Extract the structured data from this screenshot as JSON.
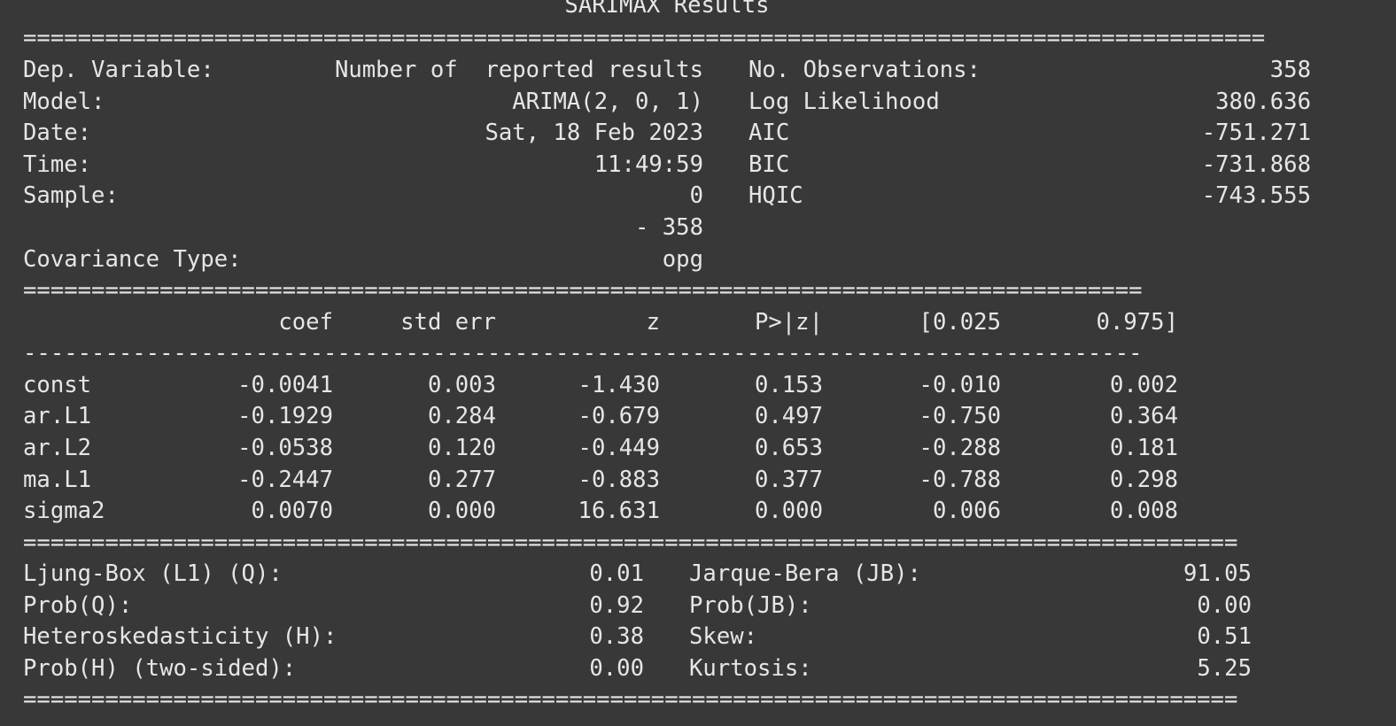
{
  "title": "SARIMAX Results",
  "separators": {
    "top": "===========================================================================================",
    "mid": "==================================================================================",
    "dash": "----------------------------------------------------------------------------------",
    "lower": "=========================================================================================",
    "bottom": "========================================================================================="
  },
  "summary": [
    {
      "l_label": "Dep. Variable:",
      "l_value": "Number of  reported results",
      "r_label": "No. Observations:",
      "r_value": "358"
    },
    {
      "l_label": "Model:",
      "l_value": "ARIMA(2, 0, 1)",
      "r_label": "Log Likelihood",
      "r_value": "380.636"
    },
    {
      "l_label": "Date:",
      "l_value": "Sat, 18 Feb 2023",
      "r_label": "AIC",
      "r_value": "-751.271"
    },
    {
      "l_label": "Time:",
      "l_value": "11:49:59",
      "r_label": "BIC",
      "r_value": "-731.868"
    },
    {
      "l_label": "Sample:",
      "l_value": "0",
      "r_label": "HQIC",
      "r_value": "-743.555"
    },
    {
      "l_label": "",
      "l_value": "- 358",
      "r_label": "",
      "r_value": ""
    },
    {
      "l_label": "Covariance Type:",
      "l_value": "opg",
      "r_label": "",
      "r_value": ""
    }
  ],
  "coef_table": {
    "headers": [
      "",
      "coef",
      "std err",
      "z",
      "P>|z|",
      "[0.025",
      "0.975]"
    ],
    "rows": [
      [
        "const",
        "-0.0041",
        "0.003",
        "-1.430",
        "0.153",
        "-0.010",
        "0.002"
      ],
      [
        "ar.L1",
        "-0.1929",
        "0.284",
        "-0.679",
        "0.497",
        "-0.750",
        "0.364"
      ],
      [
        "ar.L2",
        "-0.0538",
        "0.120",
        "-0.449",
        "0.653",
        "-0.288",
        "0.181"
      ],
      [
        "ma.L1",
        "-0.2447",
        "0.277",
        "-0.883",
        "0.377",
        "-0.788",
        "0.298"
      ],
      [
        "sigma2",
        "0.0070",
        "0.000",
        "16.631",
        "0.000",
        "0.006",
        "0.008"
      ]
    ]
  },
  "diagnostics": [
    {
      "l_label": "Ljung-Box (L1) (Q):",
      "l_value": "0.01",
      "r_label": "Jarque-Bera (JB):",
      "r_value": "91.05"
    },
    {
      "l_label": "Prob(Q):",
      "l_value": "0.92",
      "r_label": "Prob(JB):",
      "r_value": "0.00"
    },
    {
      "l_label": "Heteroskedasticity (H):",
      "l_value": "0.38",
      "r_label": "Skew:",
      "r_value": "0.51"
    },
    {
      "l_label": "Prob(H) (two-sided):",
      "l_value": "0.00",
      "r_label": "Kurtosis:",
      "r_value": "5.25"
    }
  ]
}
